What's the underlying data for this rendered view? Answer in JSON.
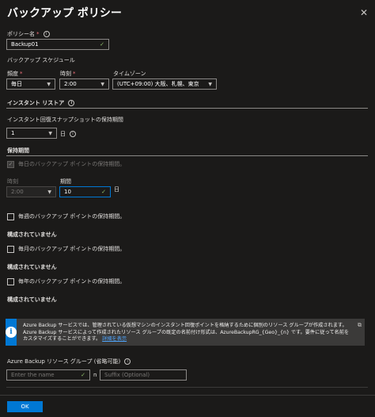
{
  "header": {
    "title": "バックアップ ポリシー",
    "close_glyph": "✕"
  },
  "policy_name": {
    "label": "ポリシー名",
    "required_mark": "*",
    "value": "Backup01"
  },
  "schedule": {
    "heading": "バックアップ スケジュール",
    "frequency": {
      "label": "頻度",
      "required_mark": "*",
      "value": "毎日"
    },
    "time": {
      "label": "時刻",
      "required_mark": "*",
      "value": "2:00"
    },
    "timezone": {
      "label": "タイムゾーン",
      "value": "(UTC+09:00) 大阪、札幌、東京"
    }
  },
  "instant_restore": {
    "heading": "インスタント リストア",
    "retention_label": "インスタント回復スナップショットの保持期間",
    "retention_value": "1",
    "unit": "日"
  },
  "retention": {
    "heading": "保持期間",
    "daily": {
      "checkbox_label": "毎日のバックアップ ポイントの保持期間。",
      "time_label": "時刻",
      "time_value": "2:00",
      "period_label": "期間",
      "period_value": "10",
      "unit": "日"
    },
    "weekly": {
      "checkbox_label": "毎週のバックアップ ポイントの保持期間。",
      "status": "構成されていません"
    },
    "monthly": {
      "checkbox_label": "毎月のバックアップ ポイントの保持期間。",
      "status": "構成されていません"
    },
    "yearly": {
      "checkbox_label": "毎年のバックアップ ポイントの保持期間。",
      "status": "構成されていません"
    }
  },
  "banner": {
    "icon_glyph": "i",
    "text": "Azure Backup サービスでは、管理されている仮想マシンのインスタント回復ポイントを格納するために個別のリソース グループが作成されます。Azure Backup サービスによって作成されたリソース グループの既定の名前付け形式は、AzureBackupRG_{Geo}_{n} です。要件に従って名前をカスタマイズすることができます。",
    "link": "詳細を表示",
    "external_glyph": "⧉"
  },
  "resource_group": {
    "label": "Azure Backup リソース グループ (省略可能)",
    "name_placeholder": "Enter the name",
    "separator": "n",
    "suffix_placeholder": "Suffix (Optional)"
  },
  "footer": {
    "ok_label": "OK"
  },
  "colors": {
    "background": "#1b1a19",
    "accent": "#0078d4",
    "required": "#f1707b",
    "valid_check": "#8fc06a",
    "focus_border": "#0078d4"
  }
}
